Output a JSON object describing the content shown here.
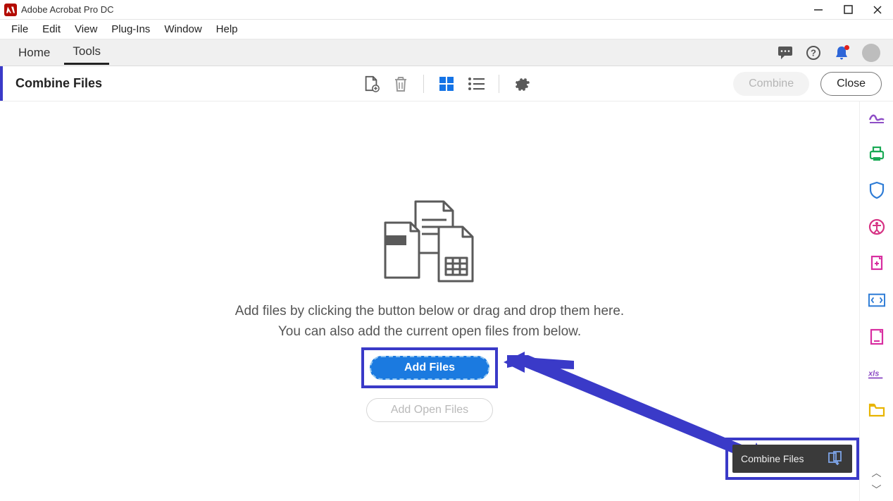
{
  "app": {
    "title": "Adobe Acrobat Pro DC"
  },
  "menu": {
    "file": "File",
    "edit": "Edit",
    "view": "View",
    "plugins": "Plug-Ins",
    "window": "Window",
    "help": "Help"
  },
  "nav": {
    "home": "Home",
    "tools": "Tools"
  },
  "toolbar": {
    "title": "Combine Files",
    "combine_label": "Combine",
    "close_label": "Close"
  },
  "main": {
    "instruction_line1": "Add files by clicking the button below or drag and drop them here.",
    "instruction_line2": "You can also add the current open files from below.",
    "add_files_label": "Add Files",
    "add_open_files_label": "Add Open Files"
  },
  "tooltip": {
    "combine_files": "Combine Files"
  },
  "rail": {
    "sign": "sign-icon",
    "export": "export-pdf-icon",
    "shield": "protect-icon",
    "accessibility": "accessibility-icon",
    "stamp": "stamp-icon",
    "html": "html-icon",
    "page": "page-icon",
    "xls": "xls",
    "folder": "folder-icon"
  }
}
